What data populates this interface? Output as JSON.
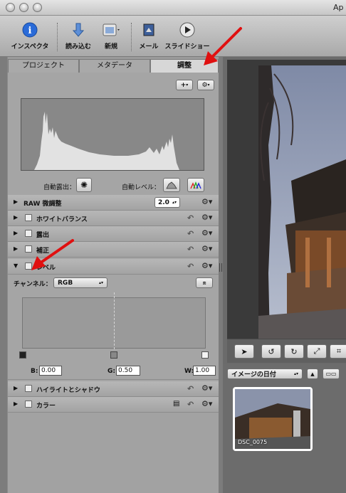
{
  "window": {
    "title": "Ap"
  },
  "toolbar": {
    "inspector": "インスペクタ",
    "import": "読み込む",
    "new": "新規",
    "mail": "メール",
    "slideshow": "スライドショー"
  },
  "tabs": {
    "project": "プロジェクト",
    "metadata": "メタデータ",
    "adjust": "調整"
  },
  "histogram": {
    "auto_exposure": "自動露出：",
    "auto_levels": "自動レベル："
  },
  "raw": {
    "label": "RAW 微調整",
    "value": "2.0"
  },
  "adjust_rows": {
    "white_balance": "ホワイトバランス",
    "exposure": "露出",
    "enhance": "補正",
    "levels": "レベル",
    "highlights_shadows": "ハイライトとシャドウ",
    "color": "カラー"
  },
  "levels": {
    "channel_label": "チャンネル：",
    "channel_value": "RGB",
    "black_label": "B:",
    "black_value": "0.00",
    "gray_label": "G:",
    "gray_value": "0.50",
    "white_label": "W:",
    "white_value": "1.00"
  },
  "browser": {
    "sort_value": "イメージの日付",
    "thumb_label": "DSC_0075"
  },
  "colors": {
    "annotation_arrow": "#e01010",
    "accent": "#2a6bd8"
  }
}
